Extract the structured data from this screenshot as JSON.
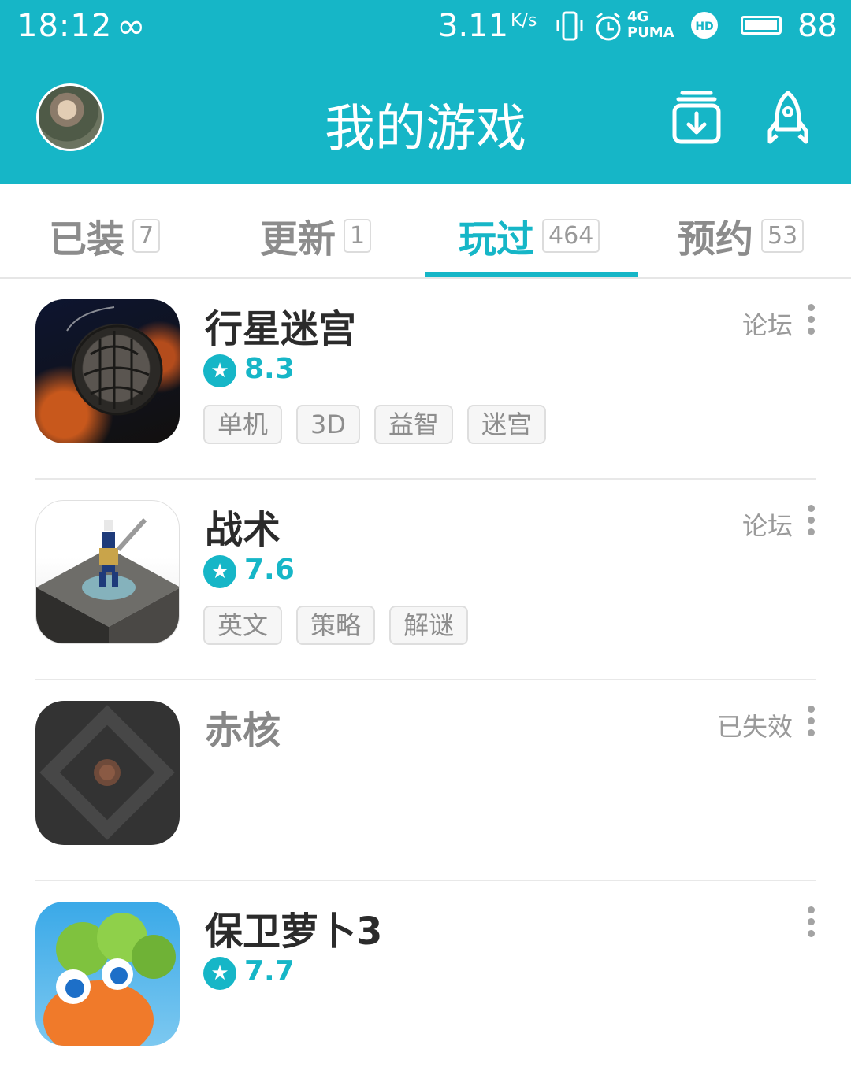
{
  "status_bar": {
    "time": "18:12",
    "infinity": "∞",
    "speed": "3.11",
    "speed_unit": "K/s",
    "network": "4G",
    "carrier": "PUMA",
    "hd": "HD",
    "battery": "88"
  },
  "header": {
    "title": "我的游戏"
  },
  "tabs": [
    {
      "label": "已装",
      "count": "7"
    },
    {
      "label": "更新",
      "count": "1"
    },
    {
      "label": "玩过",
      "count": "464"
    },
    {
      "label": "预约",
      "count": "53"
    }
  ],
  "active_tab": "玩过",
  "games": [
    {
      "name": "行星迷宫",
      "rating": "8.3",
      "tags": [
        "单机",
        "3D",
        "益智",
        "迷宫"
      ],
      "side_label": "论坛"
    },
    {
      "name": "战术",
      "rating": "7.6",
      "tags": [
        "英文",
        "策略",
        "解谜"
      ],
      "side_label": "论坛"
    },
    {
      "name": "赤核",
      "side_label": "已失效"
    },
    {
      "name": "保卫萝卜3",
      "rating": "7.7"
    }
  ],
  "icons": {
    "star": "★",
    "download": "download-box-icon",
    "rocket": "rocket-icon",
    "more": "more-vertical-icon"
  },
  "colors": {
    "accent": "#16b6c7",
    "text": "#2b2b2b",
    "muted": "#8c8c8c"
  }
}
